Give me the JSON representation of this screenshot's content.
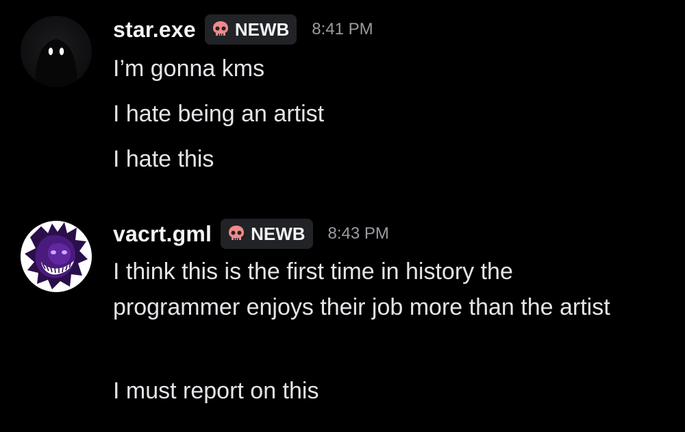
{
  "messages": [
    {
      "username": "star.exe",
      "tag": "NEWB",
      "tag_icon": "skull-icon",
      "time": "8:41 PM",
      "avatar_icon": "dark-hooded-figure-icon",
      "lines": [
        "I’m gonna kms",
        "I hate being an artist",
        "I hate this"
      ]
    },
    {
      "username": "vacrt.gml",
      "tag": "NEWB",
      "tag_icon": "skull-icon",
      "time": "8:43 PM",
      "avatar_icon": "purple-grinning-creature-icon",
      "lines": [
        "I think this is the first time in history the programmer enjoys their job more than the artist",
        "I must report on this"
      ]
    }
  ],
  "colors": {
    "background": "#000000",
    "tag_bg": "#222327",
    "skull": "#f08a8a",
    "timestamp": "#9a9ca3"
  }
}
